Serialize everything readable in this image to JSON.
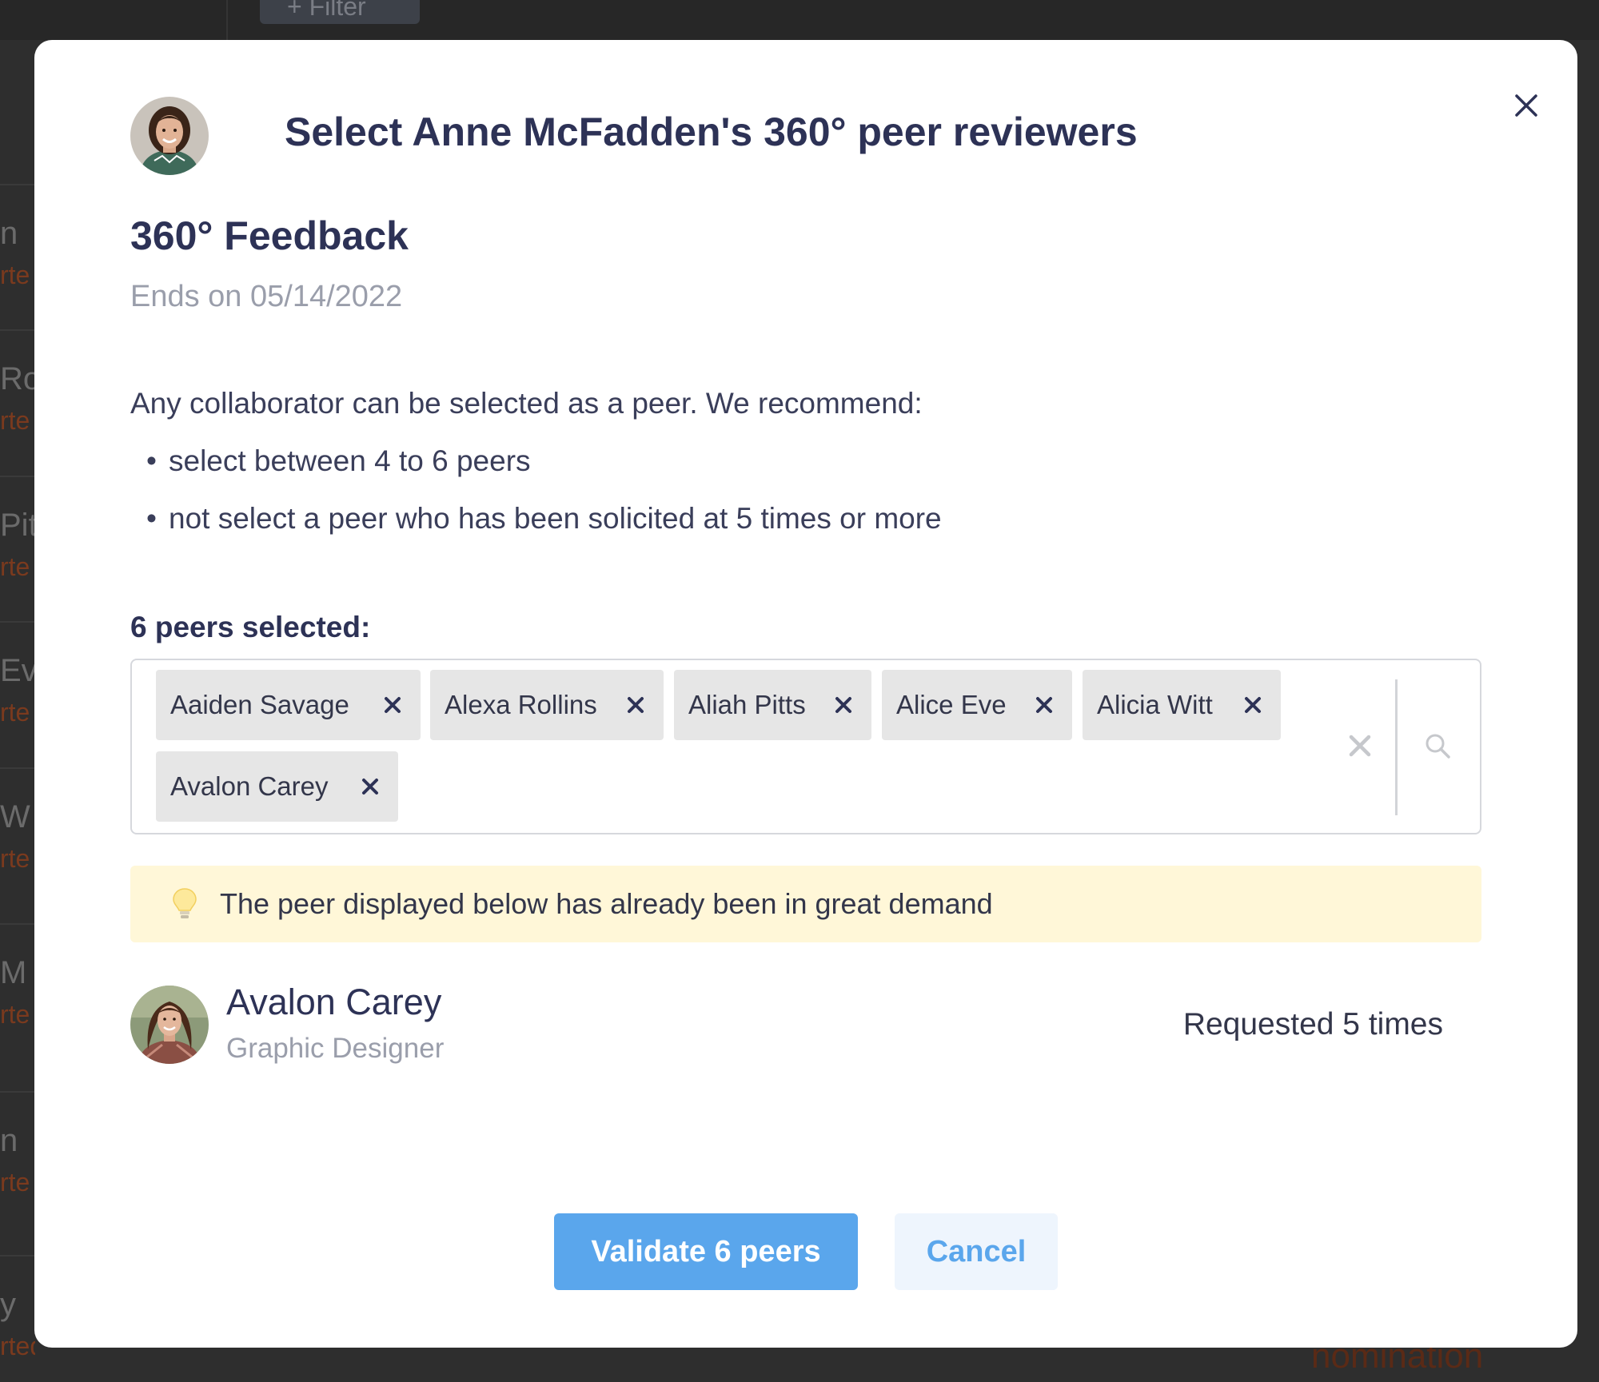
{
  "background": {
    "filter_label": "Filter",
    "rows": [
      {
        "name": "n",
        "status": "rte"
      },
      {
        "name": "Ro",
        "status": "rte"
      },
      {
        "name": "Pit",
        "status": "rte"
      },
      {
        "name": "Ev",
        "status": "rte"
      },
      {
        "name": "W",
        "status": "rte"
      },
      {
        "name": "M",
        "status": "rte"
      },
      {
        "name": "n",
        "status": "rte"
      },
      {
        "name": "y",
        "status": "rted"
      }
    ],
    "footer_right": "nomination"
  },
  "modal": {
    "title": "Select Anne McFadden's 360° peer reviewers",
    "subject_avatar": "anne-mcfadden-avatar",
    "campaign": {
      "name": "360° Feedback",
      "end": "Ends on 05/14/2022"
    },
    "intro": "Any collaborator can be selected as a peer. We recommend:",
    "recommendations": [
      "select between 4 to 6 peers",
      "not select a peer who has been solicited at 5 times or more"
    ],
    "selected_label": "6 peers selected:",
    "chips": [
      {
        "label": "Aaiden Savage"
      },
      {
        "label": "Alexa Rollins"
      },
      {
        "label": "Aliah Pitts"
      },
      {
        "label": "Alice Eve"
      },
      {
        "label": "Alicia Witt"
      },
      {
        "label": "Avalon Carey"
      }
    ],
    "warning": {
      "icon": "lightbulb-icon",
      "text": "The peer displayed below has already been in great demand"
    },
    "peer": {
      "name": "Avalon Carey",
      "role": "Graphic Designer",
      "requested": "Requested 5 times"
    },
    "buttons": {
      "validate": "Validate 6 peers",
      "cancel": "Cancel"
    }
  },
  "colors": {
    "title": "#2d3256",
    "muted": "#9a9eab",
    "primary": "#5aa6ec",
    "chip_bg": "#e6e6e6",
    "warning_bg": "#fff7d8"
  }
}
